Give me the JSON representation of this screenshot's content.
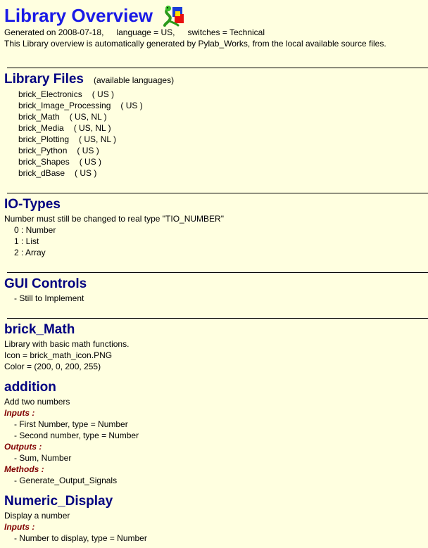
{
  "header": {
    "title": "Library Overview",
    "generated": "Generated on 2008-07-18,",
    "language": "language = US,",
    "switches": "switches = Technical",
    "description": "This Library overview is automatically generated by Pylab_Works, from the local available source files."
  },
  "library_files": {
    "heading": "Library Files",
    "note": "(available languages)",
    "items": [
      {
        "name": "brick_Electronics",
        "langs": "( US )"
      },
      {
        "name": "brick_Image_Processing",
        "langs": "( US )"
      },
      {
        "name": "brick_Math",
        "langs": "( US, NL )"
      },
      {
        "name": "brick_Media",
        "langs": "( US, NL )"
      },
      {
        "name": "brick_Plotting",
        "langs": "( US, NL )"
      },
      {
        "name": "brick_Python",
        "langs": "( US )"
      },
      {
        "name": "brick_Shapes",
        "langs": "( US )"
      },
      {
        "name": "brick_dBase",
        "langs": "( US )"
      }
    ]
  },
  "io_types": {
    "heading": "IO-Types",
    "note": "Number must still be changed to real type \"TIO_NUMBER\"",
    "items": [
      "0 : Number",
      "1 : List",
      "2 : Array"
    ]
  },
  "gui_controls": {
    "heading": "GUI Controls",
    "item": "- Still to Implement"
  },
  "brick_math": {
    "heading": "brick_Math",
    "desc": "Library with basic math functions.",
    "icon": "Icon = brick_math_icon.PNG",
    "color": "Color = (200, 0, 200, 255)"
  },
  "addition": {
    "heading": "addition",
    "desc": "Add two numbers",
    "inputs_label": "Inputs :",
    "inputs": [
      "- First Number, type = Number",
      "- Second number, type = Number"
    ],
    "outputs_label": "Outputs :",
    "outputs": [
      "- Sum, Number"
    ],
    "methods_label": "Methods :",
    "methods": [
      "- Generate_Output_Signals"
    ]
  },
  "numeric_display": {
    "heading": "Numeric_Display",
    "desc": "Display a number",
    "inputs_label": "Inputs :",
    "inputs": [
      "- Number to display, type = Number"
    ]
  },
  "colors": {
    "background": "#ffffe0",
    "title": "#1a1ae6",
    "heading": "#000080",
    "sublabel": "#800000"
  }
}
